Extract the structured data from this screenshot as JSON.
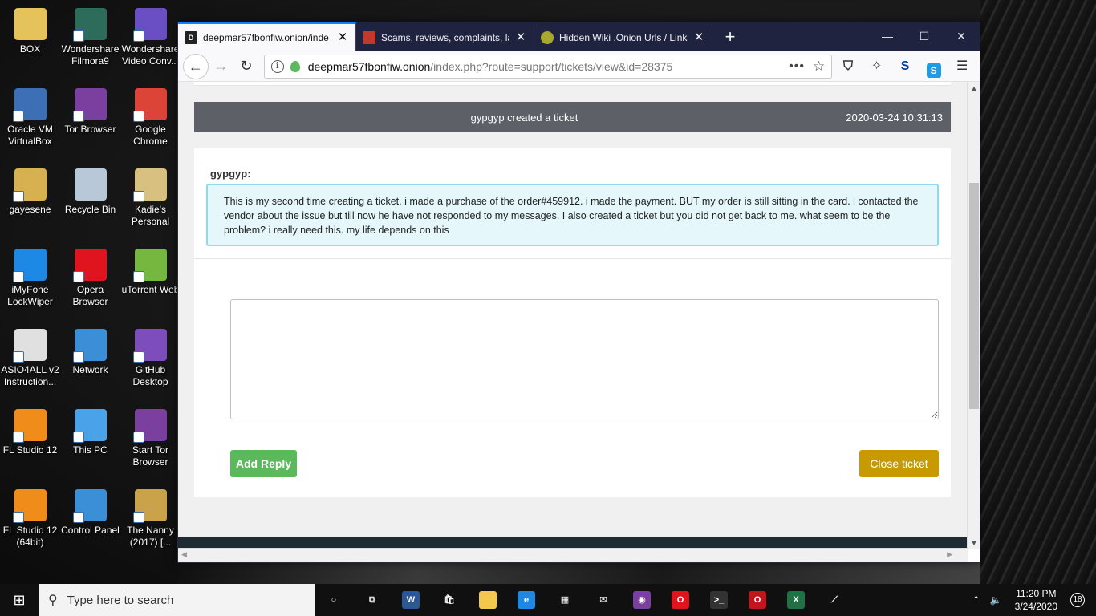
{
  "desktop": {
    "icons": [
      {
        "label": "BOX",
        "color": "#e6c35a"
      },
      {
        "label": "Wondershare Filmora9",
        "color": "#2d6b5b"
      },
      {
        "label": "Wondershare Video Conv...",
        "color": "#6a4fc4"
      },
      {
        "label": "Oracle VM VirtualBox",
        "color": "#3d6fb5"
      },
      {
        "label": "Tor Browser",
        "color": "#7b3fa0"
      },
      {
        "label": "Google Chrome",
        "color": "#db4437"
      },
      {
        "label": "gayesene",
        "color": "#d7b050"
      },
      {
        "label": "Recycle Bin",
        "color": "#b8c8d8"
      },
      {
        "label": "Kadie's Personal",
        "color": "#d8c080"
      },
      {
        "label": "iMyFone LockWiper",
        "color": "#1e88e5"
      },
      {
        "label": "Opera Browser",
        "color": "#e0141e"
      },
      {
        "label": "uTorrent Web",
        "color": "#76b83f"
      },
      {
        "label": "ASIO4ALL v2 Instruction...",
        "color": "#e0e0e0"
      },
      {
        "label": "Network",
        "color": "#3b8fd6"
      },
      {
        "label": "GitHub Desktop",
        "color": "#7c4dbb"
      },
      {
        "label": "FL Studio 12",
        "color": "#f08c1a"
      },
      {
        "label": "This PC",
        "color": "#4aa3e8"
      },
      {
        "label": "Start Tor Browser",
        "color": "#7b3fa0"
      },
      {
        "label": "FL Studio 12 (64bit)",
        "color": "#f08c1a"
      },
      {
        "label": "Control Panel",
        "color": "#3b8fd6"
      },
      {
        "label": "The Nanny (2017) [...",
        "color": "#c9a24a"
      }
    ]
  },
  "browser": {
    "tabs": [
      {
        "title": "deepmar57fbonfiw.onion/inde",
        "favicon_text": "D",
        "favicon_color": "#222222",
        "active": true
      },
      {
        "title": "Scams, reviews, complaints, lav",
        "favicon_text": "",
        "favicon_color": "#c0392b",
        "active": false
      },
      {
        "title": "Hidden Wiki .Onion Urls / Links",
        "favicon_text": "",
        "favicon_color": "#a8a830",
        "active": false
      }
    ],
    "tab_close": "✕",
    "new_tab": "+",
    "window_controls": {
      "minimize": "—",
      "maximize": "☐",
      "close": "✕"
    },
    "nav": {
      "back": "←",
      "forward": "→",
      "reload": "↻"
    },
    "url_host": "deepmar57fbonfiw.onion",
    "url_path": "/index.php?route=support/tickets/view&id=28375",
    "url_info": "i",
    "page_actions": "•••",
    "bookmark": "☆",
    "toolbar_icons": [
      "shield-icon",
      "extension-icon",
      "skype-icon",
      "skype-blue-icon",
      "menu-icon"
    ],
    "toolbar_glyphs": {
      "shield": "⛉",
      "ext": "✧",
      "s1": "S",
      "s2": "S",
      "menu": "☰"
    }
  },
  "ticket": {
    "header_text": "gypgyp created a ticket",
    "timestamp": "2020-03-24 10:31:13",
    "author": "gypgyp:",
    "message": "This is my second time creating a ticket. i made a purchase of the order#459912. i made the payment. BUT my order is still sitting in the card. i contacted the vendor about the issue but till now he have not responded to my messages. I also created a ticket but you did not get back to me. what seem to be the problem? i really need this. my life depends on this",
    "reply_placeholder": "",
    "add_reply_label": "Add Reply",
    "close_ticket_label": "Close ticket"
  },
  "taskbar": {
    "start": "⊞",
    "search_placeholder": "Type here to search",
    "search_icon": "⚲",
    "apps": [
      {
        "name": "cortana-icon",
        "text": "○",
        "color": "transparent"
      },
      {
        "name": "task-view-icon",
        "text": "⧉",
        "color": "transparent"
      },
      {
        "name": "word-icon",
        "text": "W",
        "color": "#2b5797"
      },
      {
        "name": "store-icon",
        "text": "🛍",
        "color": "transparent"
      },
      {
        "name": "file-explorer-icon",
        "text": "",
        "color": "#f2c94c"
      },
      {
        "name": "edge-icon",
        "text": "e",
        "color": "#1e88e5"
      },
      {
        "name": "calculator-icon",
        "text": "▦",
        "color": "transparent"
      },
      {
        "name": "mail-icon",
        "text": "✉",
        "color": "transparent"
      },
      {
        "name": "tor-icon",
        "text": "◉",
        "color": "#7b3fa0"
      },
      {
        "name": "opera-icon",
        "text": "O",
        "color": "#e0141e"
      },
      {
        "name": "cmd-icon",
        "text": ">_",
        "color": "#333333"
      },
      {
        "name": "opera-gx-icon",
        "text": "O",
        "color": "#c0151c"
      },
      {
        "name": "excel-icon",
        "text": "X",
        "color": "#1f7244"
      },
      {
        "name": "dev-tool-icon",
        "text": "⟋",
        "color": "transparent"
      }
    ],
    "tray_chevron": "⌃",
    "volume": "🔈",
    "time": "11:20 PM",
    "date": "3/24/2020",
    "notifications": "18"
  },
  "colors": {
    "ticket_header_bg": "#5e6068",
    "message_bg": "#e5f7fb",
    "message_border": "#8fdbe8",
    "add_reply_bg": "#5cb85c",
    "close_ticket_bg": "#c79a00"
  }
}
